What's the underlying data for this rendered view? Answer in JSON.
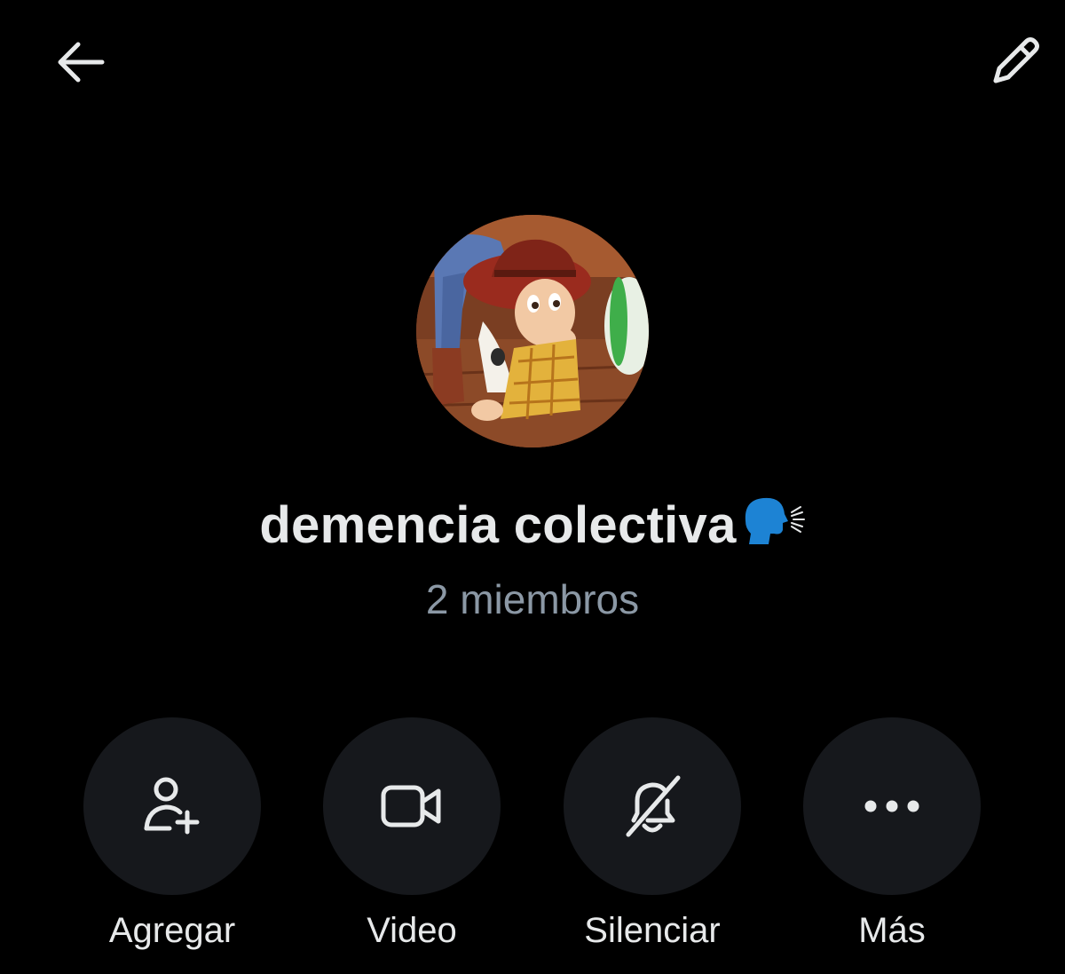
{
  "header": {
    "back_icon": "arrow-left-icon",
    "edit_icon": "pencil-icon"
  },
  "group": {
    "avatar": "woody-toy-story-avatar",
    "name": "demencia colectiva",
    "name_emoji": "🗣",
    "members_text": "2 miembros"
  },
  "actions": [
    {
      "label": "Agregar",
      "icon": "add-person-icon"
    },
    {
      "label": "Video",
      "icon": "video-camera-icon"
    },
    {
      "label": "Silenciar",
      "icon": "bell-slash-icon"
    },
    {
      "label": "Más",
      "icon": "more-dots-icon"
    }
  ],
  "colors": {
    "background": "#000000",
    "text_primary": "#e7e9ea",
    "text_secondary": "#8b98a5",
    "action_circle": "#16181c",
    "emoji_blue": "#1d83d4"
  }
}
